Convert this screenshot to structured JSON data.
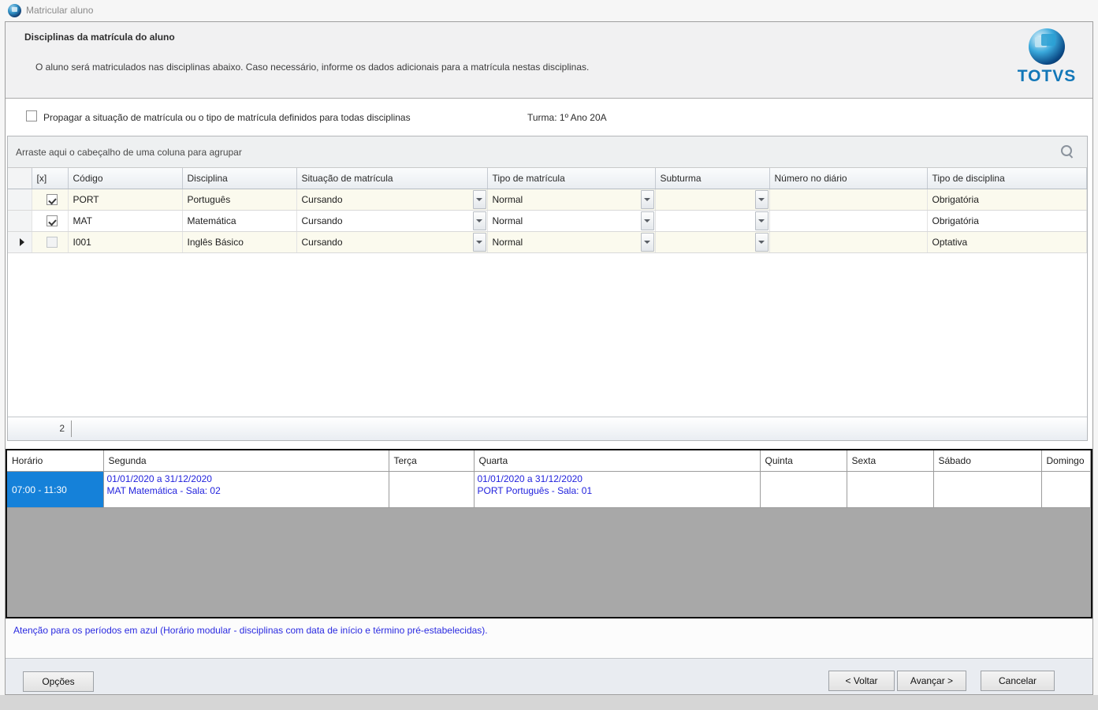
{
  "window": {
    "title": "Matricular aluno"
  },
  "header": {
    "title": "Disciplinas da matrícula do aluno",
    "description": "O aluno será matriculados nas disciplinas abaixo. Caso necessário, informe os dados adicionais para a matrícula nestas disciplinas.",
    "logo_text": "TOTVS"
  },
  "options": {
    "propagate_label": "Propagar a situação de matrícula ou o tipo de matrícula definidos para todas disciplinas",
    "propagate_checked": false,
    "turma": "Turma: 1º Ano 20A"
  },
  "grid": {
    "group_hint": "Arraste aqui o cabeçalho de uma coluna para agrupar",
    "columns": [
      "[x]",
      "Código",
      "Disciplina",
      "Situação de matrícula",
      "Tipo de matrícula",
      "Subturma",
      "Número no diário",
      "Tipo de disciplina"
    ],
    "rows": [
      {
        "checked": true,
        "disabled": false,
        "current": false,
        "codigo": "PORT",
        "disciplina": "Português",
        "situacao": "Cursando",
        "tipo_matricula": "Normal",
        "subturma": "",
        "numero_diario": "",
        "tipo_disciplina": "Obrigatória"
      },
      {
        "checked": true,
        "disabled": false,
        "current": false,
        "codigo": "MAT",
        "disciplina": "Matemática",
        "situacao": "Cursando",
        "tipo_matricula": "Normal",
        "subturma": "",
        "numero_diario": "",
        "tipo_disciplina": "Obrigatória"
      },
      {
        "checked": false,
        "disabled": true,
        "current": true,
        "codigo": "I001",
        "disciplina": "Inglês Básico",
        "situacao": "Cursando",
        "tipo_matricula": "Normal",
        "subturma": "",
        "numero_diario": "",
        "tipo_disciplina": "Optativa"
      }
    ],
    "footer_count": "2"
  },
  "schedule": {
    "columns": [
      "Horário",
      "Segunda",
      "Terça",
      "Quarta",
      "Quinta",
      "Sexta",
      "Sábado",
      "Domingo"
    ],
    "rows": [
      {
        "horario": "07:00 - 11:30",
        "cells": [
          {
            "lines": [
              "01/01/2020 a 31/12/2020",
              "MAT  Matemática - Sala: 02"
            ]
          },
          {
            "lines": []
          },
          {
            "lines": [
              "01/01/2020 a 31/12/2020",
              "PORT  Português - Sala: 01"
            ]
          },
          {
            "lines": []
          },
          {
            "lines": []
          },
          {
            "lines": []
          },
          {
            "lines": []
          }
        ]
      }
    ]
  },
  "notice": "Atenção para os períodos em azul (Horário modular - disciplinas com data de início e término pré-estabelecidas).",
  "buttons": {
    "opcoes": "Opções",
    "voltar": "< Voltar",
    "avancar": "Avançar >",
    "cancelar": "Cancelar"
  },
  "colors": {
    "time_cell_blue": "#1581d9",
    "schedule_text_blue": "#2222dd",
    "notice_text_blue": "#2a2ae0",
    "logo_blue": "#1277b8",
    "alt_row": "#fbfaee",
    "filler_gray": "#a8a8a8"
  }
}
